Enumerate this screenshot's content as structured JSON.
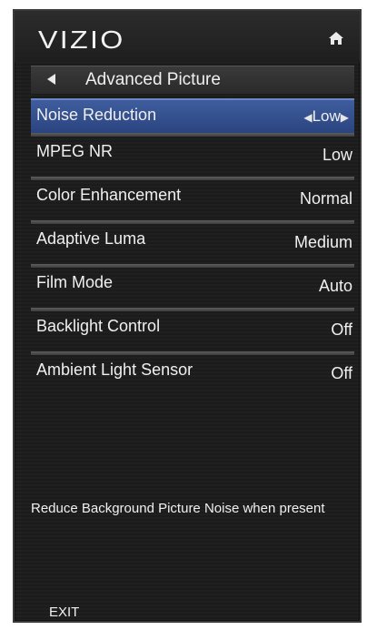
{
  "brand": "VIZIO",
  "header": {
    "title": "Advanced Picture",
    "back_icon": "back-arrow-icon",
    "home_icon": "home-icon"
  },
  "menu": [
    {
      "label": "Noise Reduction",
      "value": "Low",
      "selected": true
    },
    {
      "label": "MPEG NR",
      "value": "Low",
      "selected": false
    },
    {
      "label": "Color Enhancement",
      "value": "Normal",
      "selected": false
    },
    {
      "label": "Adaptive Luma",
      "value": "Medium",
      "selected": false
    },
    {
      "label": "Film Mode",
      "value": "Auto",
      "selected": false
    },
    {
      "label": "Backlight Control",
      "value": "Off",
      "selected": false
    },
    {
      "label": "Ambient Light Sensor",
      "value": "Off",
      "selected": false
    }
  ],
  "description": "Reduce Background Picture Noise when present",
  "footer": {
    "exit_label": "EXIT"
  },
  "colors": {
    "background": "#1b1b1b",
    "selection": "#3f5d9e",
    "text": "#f0f0f0"
  }
}
